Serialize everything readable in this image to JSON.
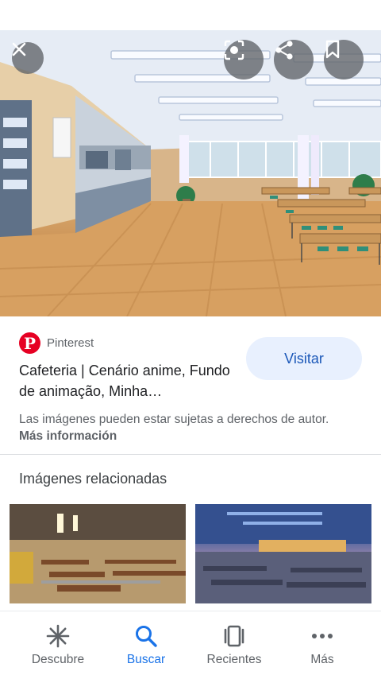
{
  "hero": {
    "close_icon": "close-icon",
    "lens_icon": "lens-icon",
    "share_icon": "share-icon",
    "save_icon": "bookmark-icon"
  },
  "result": {
    "source_name": "Pinterest",
    "source_logo_letter": "P",
    "title": "Cafeteria | Cenário anime, Fundo de animação, Minha…",
    "visit_label": "Visitar",
    "rights_text": "Las imágenes pueden estar sujetas a derechos de autor.",
    "more_info_label": "Más información"
  },
  "related": {
    "heading": "Imágenes relacionadas"
  },
  "bottom_nav": {
    "items": [
      {
        "label": "Descubre",
        "icon": "asterisk-icon",
        "active": false
      },
      {
        "label": "Buscar",
        "icon": "search-icon",
        "active": true
      },
      {
        "label": "Recientes",
        "icon": "recents-icon",
        "active": false
      },
      {
        "label": "Más",
        "icon": "more-dots-icon",
        "active": false
      }
    ]
  },
  "colors": {
    "accent": "#1a73e8",
    "visit_bg": "#e8f0fe",
    "pinterest_red": "#e60023"
  }
}
